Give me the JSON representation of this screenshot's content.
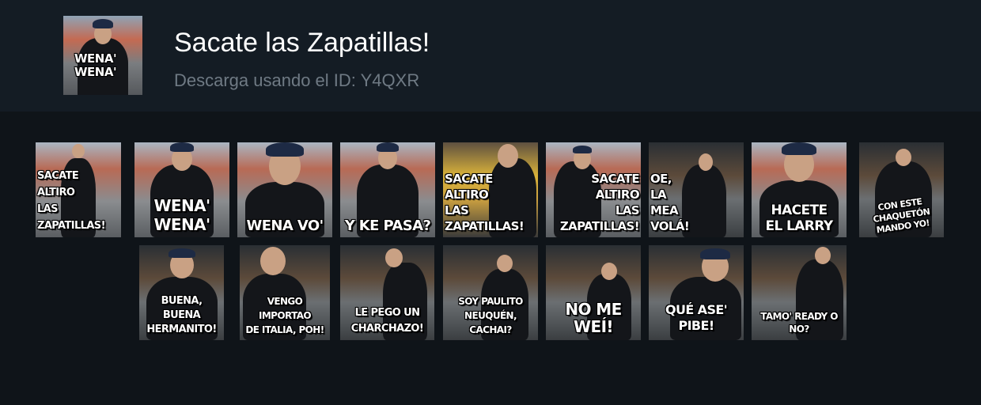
{
  "header": {
    "title": "Sacate las Zapatillas!",
    "subtitle": "Descarga usando el ID: Y4QXR",
    "cover_text": "WENA'\nWENA'"
  },
  "stickers_row1": [
    {
      "text": "SACATE\nALTIRO\nLAS\nZAPATILLAS!"
    },
    {
      "text": "WENA'\nWENA'"
    },
    {
      "text": "WENA VO'"
    },
    {
      "text": "Y KE PASA?"
    },
    {
      "text": "SACATE\nALTIRO\nLAS\nZAPATILLAS!"
    },
    {
      "text": "SACATE\nALTIRO\nLAS\nZAPATILLAS!"
    },
    {
      "text": "OE,\nLA\nMEA\nVOLÁ!"
    },
    {
      "text": "HACETE\nEL LARRY"
    },
    {
      "text": "CON ESTE CHAQUETÓN\nMANDO YO!"
    }
  ],
  "stickers_row2": [
    {
      "text": "BUENA, BUENA\nHERMANITO!"
    },
    {
      "text": "VENGO IMPORTAO\nDE ITALIA, POH!"
    },
    {
      "text": "LE PEGO UN\nCHARCHAZO!"
    },
    {
      "text": "SOY PAULITO\nNEUQUÉN, CACHAI?"
    },
    {
      "text": "NO ME WEÍ!"
    },
    {
      "text": "QUÉ ASE' PIBE!"
    },
    {
      "text": "TAMO' READY O NO?"
    }
  ]
}
